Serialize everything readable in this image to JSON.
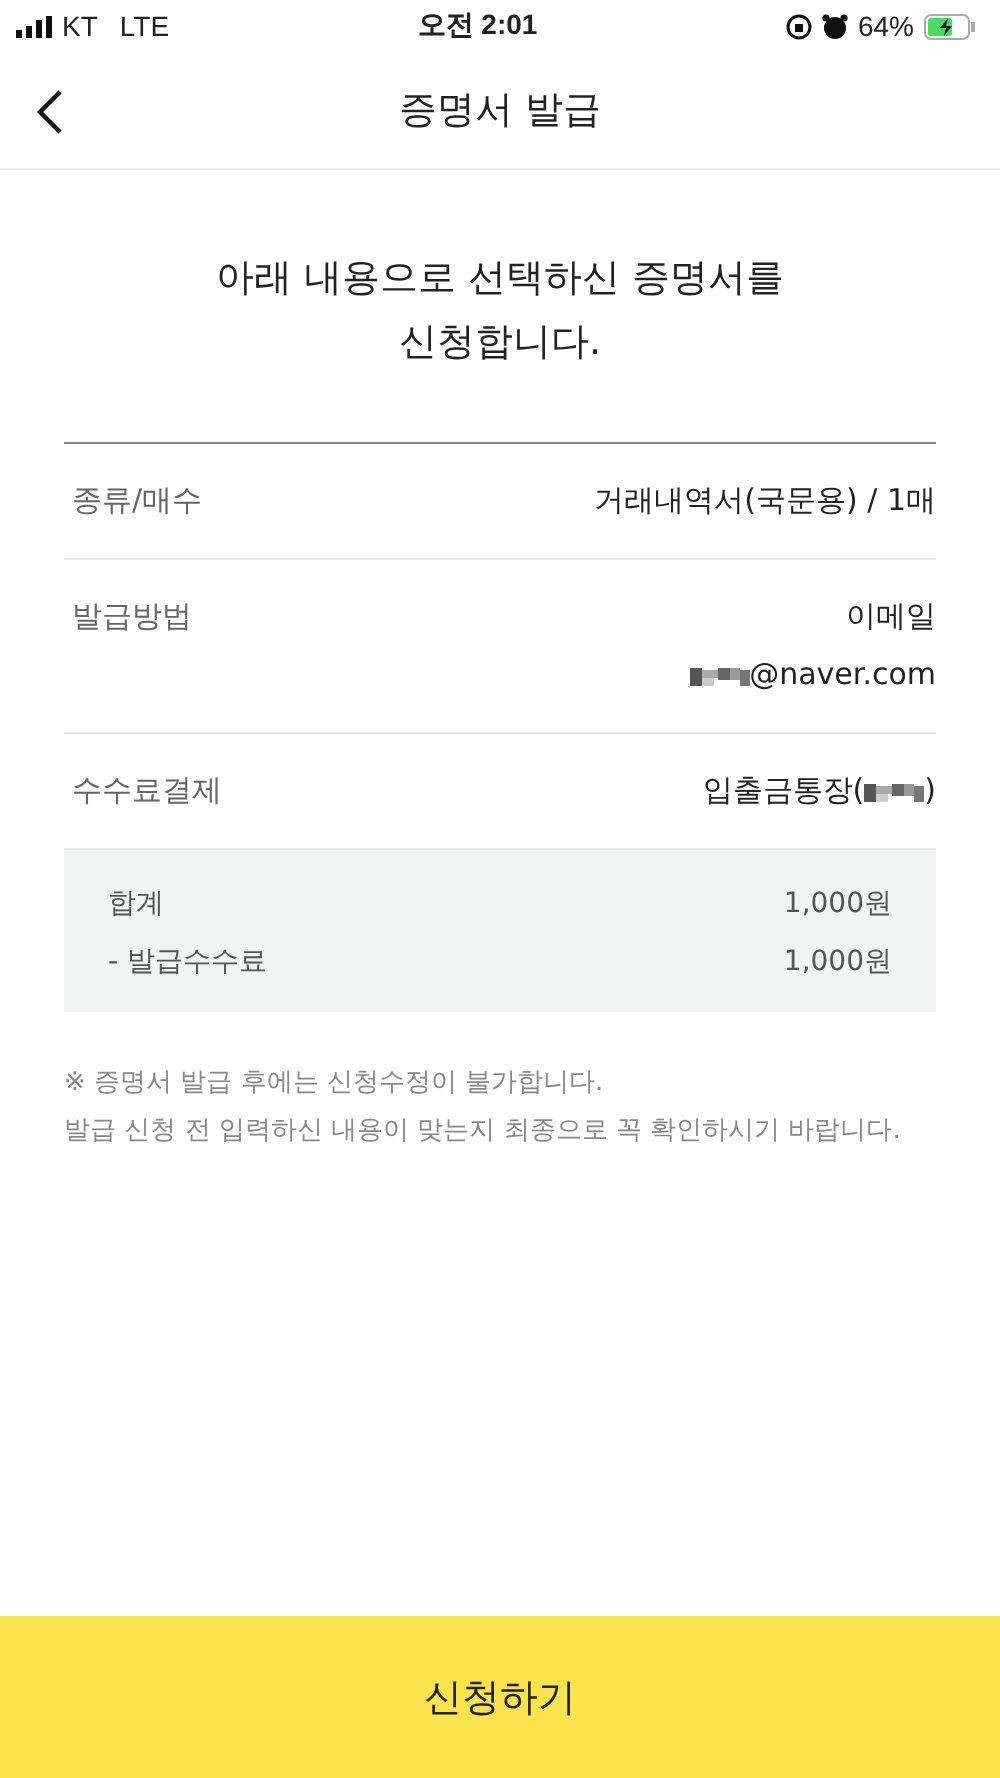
{
  "status_bar": {
    "carrier": "KT",
    "network": "LTE",
    "time": "오전 2:01",
    "battery": "64%",
    "charging": true
  },
  "nav": {
    "title": "증명서 발급"
  },
  "heading": [
    "아래 내용으로 선택하신 증명서를",
    "신청합니다."
  ],
  "rows": [
    {
      "label": "종류/매수",
      "lines": [
        [
          {
            "kind": "text",
            "text": "거래내역서(국문용) / 1매"
          }
        ]
      ]
    },
    {
      "label": "발급방법",
      "lines": [
        [
          {
            "kind": "text",
            "text": "이메일"
          }
        ],
        [
          {
            "kind": "redacted"
          },
          {
            "kind": "text",
            "text": "@naver.com"
          }
        ]
      ]
    },
    {
      "label": "수수료결제",
      "lines": [
        [
          {
            "kind": "text",
            "text": "입출금통장("
          },
          {
            "kind": "redacted"
          },
          {
            "kind": "text",
            "text": ")"
          }
        ]
      ]
    }
  ],
  "summary": [
    {
      "label": "합계",
      "amount": "1,000원"
    },
    {
      "label": "- 발급수수료",
      "amount": "1,000원"
    }
  ],
  "notice": [
    "※ 증명서 발급 후에는 신청수정이 불가합니다.",
    "발급 신청 전 입력하신 내용이 맞는지 최종으로 꼭 확인하시기 바랍니다."
  ],
  "submit": "신청하기"
}
